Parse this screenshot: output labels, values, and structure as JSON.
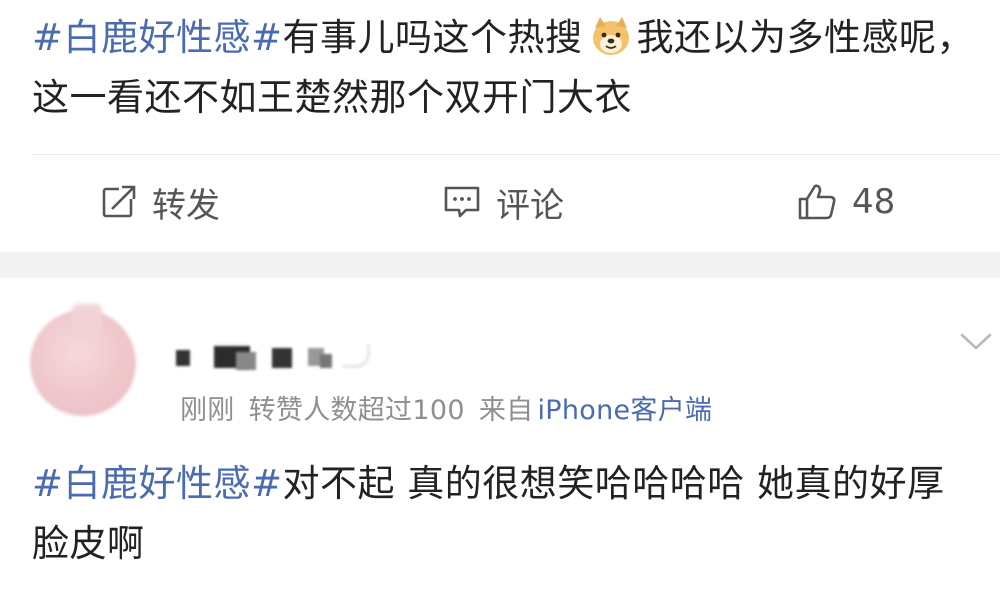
{
  "post1": {
    "hashtag": "#白鹿好性感#",
    "text_before_emoji": "有事儿吗这个热搜",
    "emoji": "doge-emoji",
    "text_after_emoji": "我还以为多性感呢，这一看还不如王楚然那个双开门大衣",
    "actions": {
      "repost_label": "转发",
      "comment_label": "评论",
      "like_count": "48"
    }
  },
  "post2": {
    "meta": {
      "time": "刚刚",
      "repost_likes": "转赞人数超过100",
      "source_prefix": "来自",
      "client": "iPhone客户端"
    },
    "hashtag": "#白鹿好性感#",
    "text": "对不起 真的很想笑哈哈哈哈 她真的好厚脸皮啊"
  },
  "colors": {
    "hashtag": "#4a6bb0",
    "text": "#222222",
    "meta": "#8f8f8f",
    "band": "#f2f2f2",
    "avatar": "#efc6ca"
  },
  "icons": [
    "repost-icon",
    "comment-icon",
    "like-icon",
    "chevron-down-icon",
    "doge-emoji"
  ]
}
